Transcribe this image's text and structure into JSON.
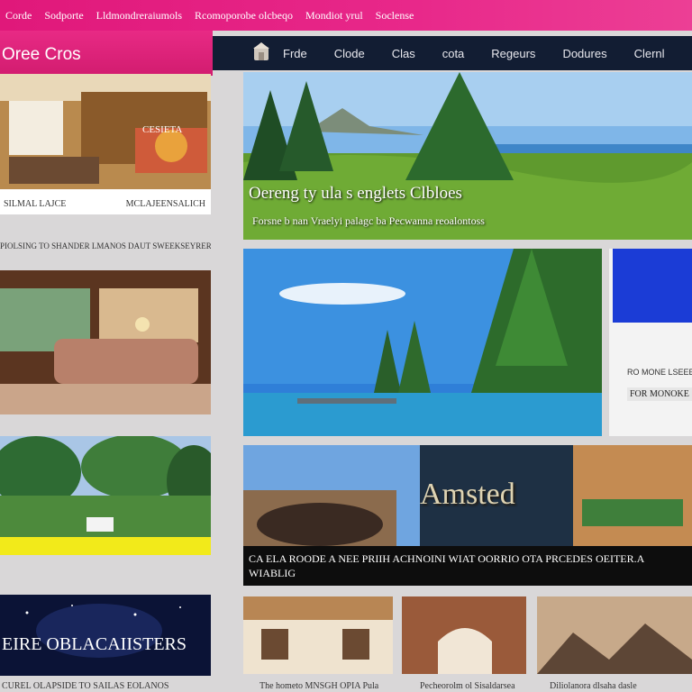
{
  "topnav": [
    "Corde",
    "Sodporte",
    "Lldmondreraiumols",
    "Rcomoporobe olcbeqo",
    "Mondiot yrul",
    "Soclense"
  ],
  "brand": "Oree Cros",
  "nav": {
    "home_icon": "home-icon",
    "items": [
      "Frde",
      "Clode",
      "Clas",
      "cota",
      "Regeurs",
      "Dodures",
      "Clernl"
    ]
  },
  "left": {
    "card1": {
      "tag": "CESIETA",
      "caption_left": "SILMAL LAJCE",
      "caption_right": "MCLAJEENSALICH"
    },
    "section_label": "PIOLSING TO SHANDER LMANOS DAUT SWEEKSEYRERSERIIO DHE PRETLYET",
    "card4_title": "EIRE OBLACAIISTERS"
  },
  "hero": {
    "title": "Oereng ty ula s englets Clbloes",
    "subtitle": "Forsne b nan Vraelyi palagc ba Pecwanna reoalontoss"
  },
  "side": {
    "line1": "RO MONE LSEEEA",
    "line2": "FOR MONOKE"
  },
  "trip": {
    "big_text": "Amsted",
    "caption": "CA ELA ROODE A NEE PRIIH ACHNOINI WIAT OORRIO OTA PRCEDES OEITER.A WIABLIG"
  },
  "bottom_captions": [
    "CUREL OLAPSIDE TO SAILAS EOLANOS",
    "The hometo MNSGH OPIA Pula",
    "Pecheorolm ol Sisaldarsea",
    "Diliolanora dlsaha dasle"
  ],
  "colors": {
    "accent": "#e0187a",
    "nav": "#121d33"
  }
}
